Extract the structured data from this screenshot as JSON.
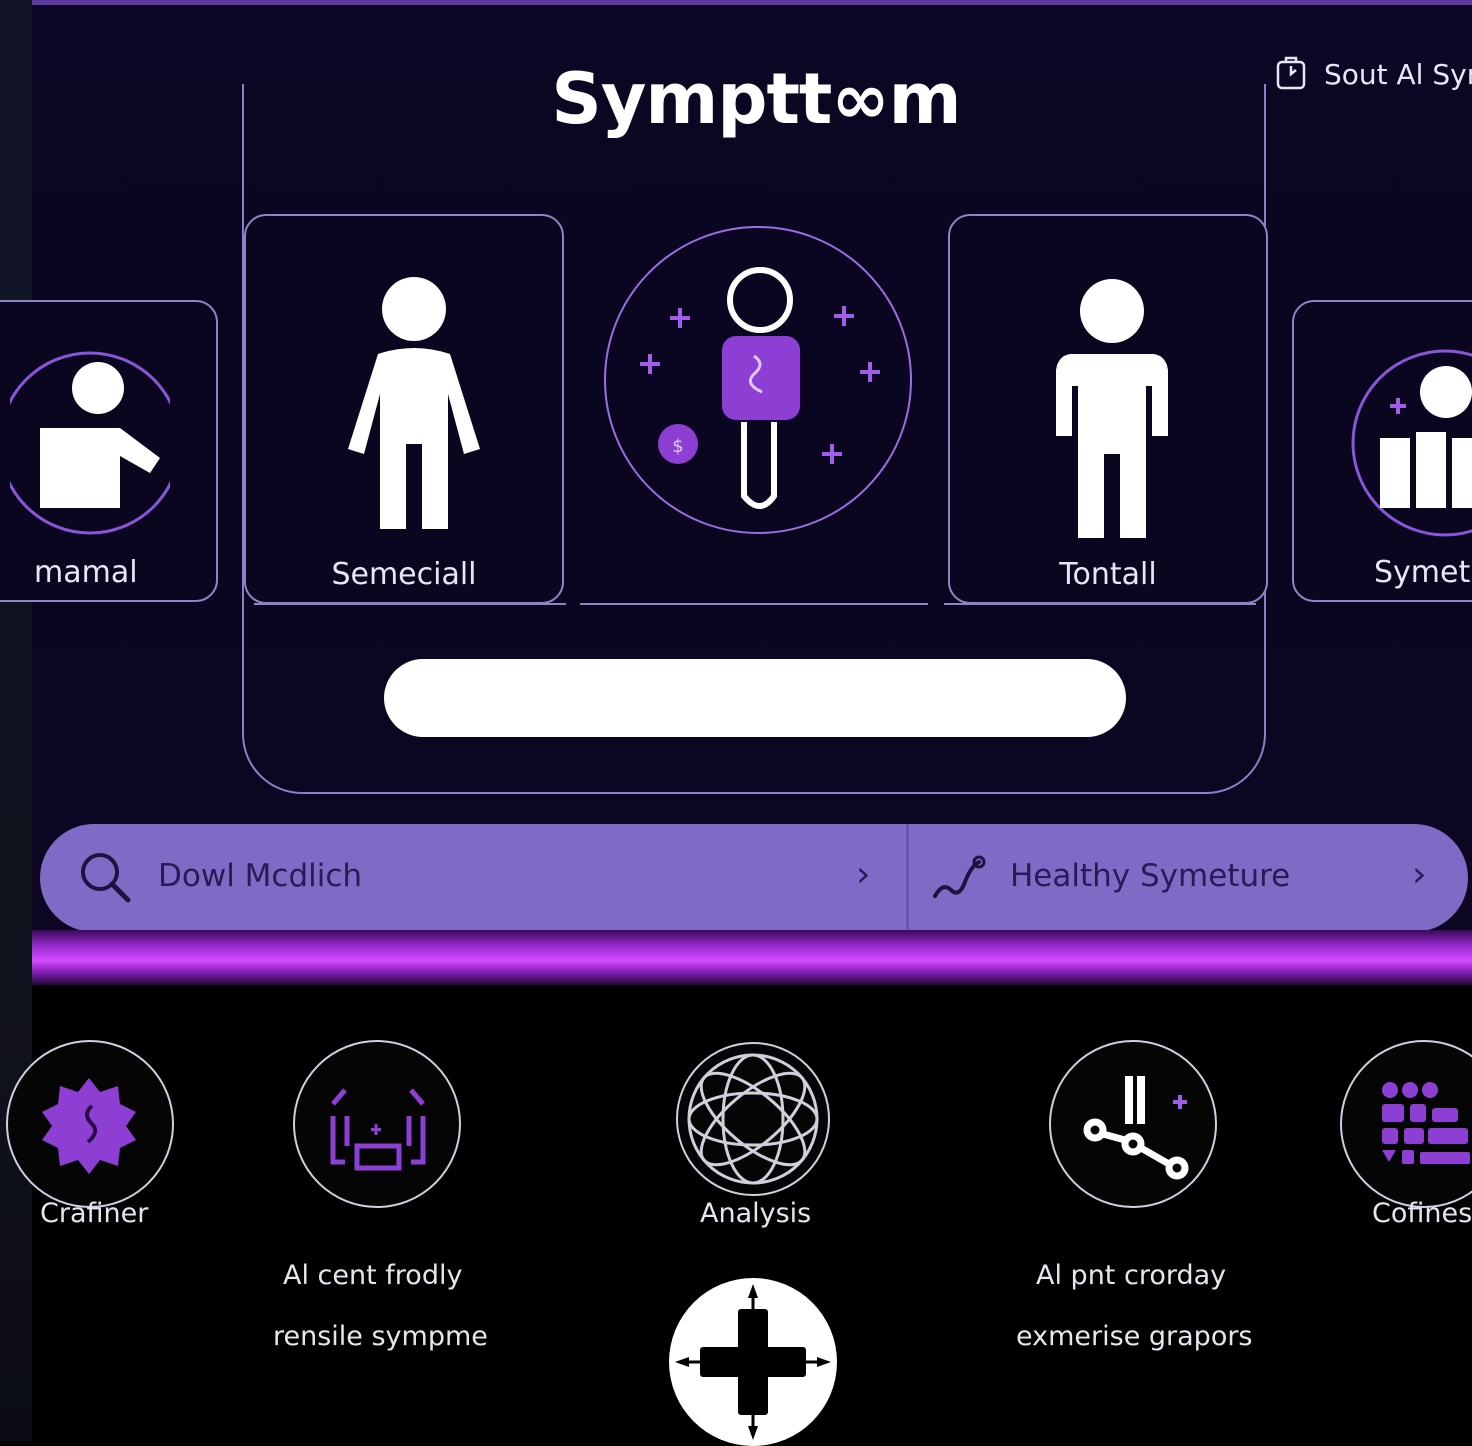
{
  "app": {
    "title": "Symptt∞m"
  },
  "header": {
    "link_text": "Sout Al Sym"
  },
  "cards": [
    {
      "label": "mamal"
    },
    {
      "label": "Semeciall"
    },
    {
      "label": "Tontall"
    },
    {
      "label": "Symeti"
    }
  ],
  "search_bar": {
    "left_text": "Dowl Mcdlich",
    "right_text": "Healthy Symeture",
    "chevron": "›"
  },
  "bottom_icons": [
    {
      "label": "Crafiner"
    },
    {
      "label": ""
    },
    {
      "label": "Analysis"
    },
    {
      "label": ""
    },
    {
      "label": "Cofines"
    }
  ],
  "bottom_texts": {
    "left_line1": "Al cent frodly",
    "left_line2": "rensile sympme",
    "right_line1": "Al pnt crorday",
    "right_line2": "exmerise grapors"
  },
  "colors": {
    "accent_purple": "#7f6bc6",
    "glow_magenta": "#d34bff",
    "icon_purple": "#8c3fd2",
    "panel_bg": "#0a0620"
  }
}
